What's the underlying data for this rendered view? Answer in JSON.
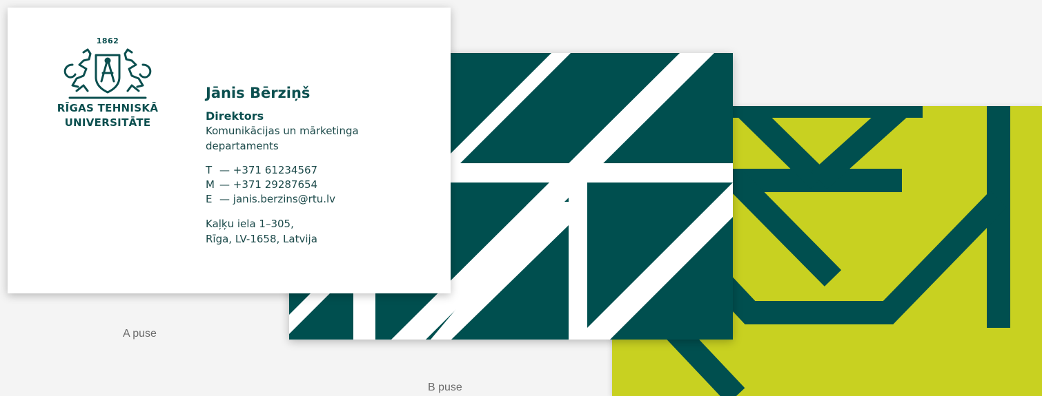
{
  "front": {
    "logo": {
      "year": "1862",
      "line1": "RĪGAS TEHNISKĀ",
      "line2": "UNIVERSITĀTE"
    },
    "name": "Jānis Bērziņš",
    "title": "Direktors",
    "department": "Komunikācijas un mārketinga departaments",
    "contacts": [
      {
        "key": "T",
        "sep": "—",
        "value": "+371 61234567"
      },
      {
        "key": "M",
        "sep": "—",
        "value": "+371 29287654"
      },
      {
        "key": "E",
        "sep": "—",
        "value": "janis.berzins@rtu.lv"
      }
    ],
    "address_line1": "Kaļķu iela 1–305,",
    "address_line2": "Rīga, LV-1658, Latvija"
  },
  "captions": {
    "a": "A puse",
    "b": "B puse"
  },
  "colors": {
    "dark_green": "#004f4f",
    "lime": "#c8d121",
    "white": "#ffffff",
    "background": "#f4f4f4"
  }
}
